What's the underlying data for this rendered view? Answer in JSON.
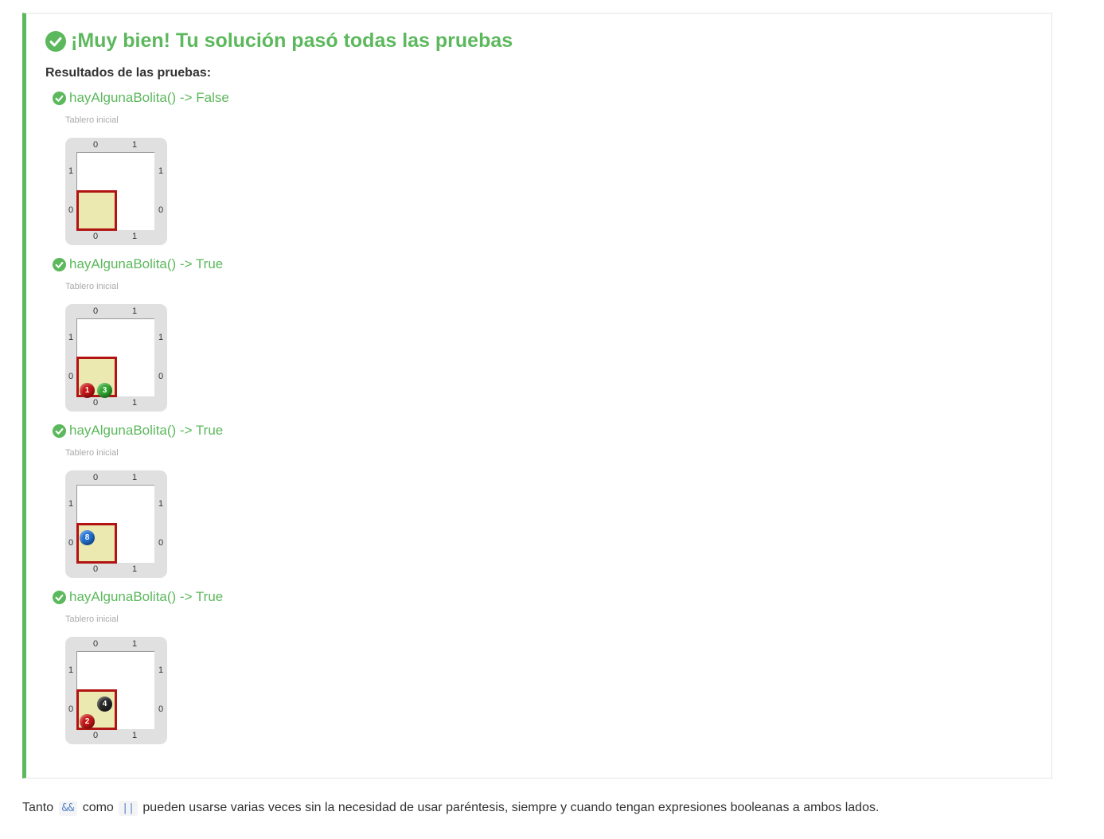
{
  "result": {
    "title": "¡Muy bien! Tu solución pasó todas las pruebas",
    "subtitle": "Resultados de las pruebas:",
    "accent_color": "#5cb85c",
    "tests": [
      {
        "title": "hayAlgunaBolita() -> False",
        "board_label": "Tablero inicial",
        "board": {
          "columns": [
            "0",
            "1"
          ],
          "rows": [
            "1",
            "0"
          ],
          "head": [
            0,
            0
          ],
          "balls": []
        }
      },
      {
        "title": "hayAlgunaBolita() -> True",
        "board_label": "Tablero inicial",
        "board": {
          "columns": [
            "0",
            "1"
          ],
          "rows": [
            "1",
            "0"
          ],
          "head": [
            0,
            0
          ],
          "balls": [
            {
              "color": "red",
              "count": "1"
            },
            {
              "color": "green",
              "count": "3"
            }
          ]
        }
      },
      {
        "title": "hayAlgunaBolita() -> True",
        "board_label": "Tablero inicial",
        "board": {
          "columns": [
            "0",
            "1"
          ],
          "rows": [
            "1",
            "0"
          ],
          "head": [
            0,
            0
          ],
          "balls": [
            {
              "color": "blue",
              "count": "8"
            }
          ]
        }
      },
      {
        "title": "hayAlgunaBolita() -> True",
        "board_label": "Tablero inicial",
        "board": {
          "columns": [
            "0",
            "1"
          ],
          "rows": [
            "1",
            "0"
          ],
          "head": [
            0,
            0
          ],
          "balls": [
            {
              "color": "black",
              "count": "4"
            },
            {
              "color": "red",
              "count": "2"
            }
          ]
        }
      }
    ]
  },
  "footer": {
    "text_1": "Tanto",
    "code_1": "&&",
    "text_2": "como",
    "code_2": "||",
    "text_3": "pueden usarse varias veces sin la necesidad de usar paréntesis, siempre y cuando tengan expresiones booleanas a ambos lados."
  },
  "colors": {
    "red": "#c41414",
    "green": "#2fa52f",
    "blue": "#1f6fd1",
    "black": "#262626"
  }
}
